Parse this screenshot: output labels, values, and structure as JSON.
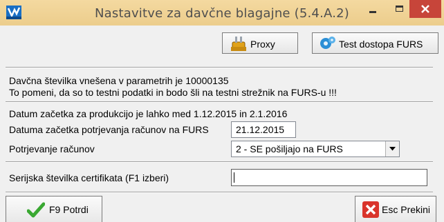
{
  "window": {
    "title": "Nastavitve za davčne blagajne   (5.4.A.2)",
    "icons": {
      "app": "app-logo-icon",
      "minimize": "minimize-icon",
      "maximize": "maximize-icon",
      "close": "close-icon"
    }
  },
  "toolbar": {
    "proxy_label": "Proxy",
    "proxy_icon": "proxy-plug-icon",
    "test_label": "Test dostopa FURS",
    "test_icon": "gear-icon"
  },
  "info": {
    "line1": "Davčna številka vnešena v parametrih je 10000135",
    "line2": "To pomeni, da so to testni podatki in bodo šli na testni strežnik na FURS-u !!!"
  },
  "settings": {
    "production_note": "Datum začetka za produkcijo je lahko med 1.12.2015 in 2.1.2016",
    "start_date_label": "Datuma začetka potrjevanja računov na FURS",
    "start_date_value": "21.12.2015",
    "confirm_label": "Potrjevanje računov",
    "confirm_value": "2 - SE pošiljajo na FURS",
    "cert_label": "Serijska številka certifikata (F1 izberi)",
    "cert_value": ""
  },
  "buttons": {
    "confirm_label": "F9 Potrdi",
    "confirm_icon": "checkmark-icon",
    "cancel_label": "Esc Prekini",
    "cancel_icon": "red-x-icon"
  },
  "colors": {
    "titlebar": "#f0d394",
    "close_button": "#c7453a",
    "window_bg": "#f0f0f0"
  }
}
